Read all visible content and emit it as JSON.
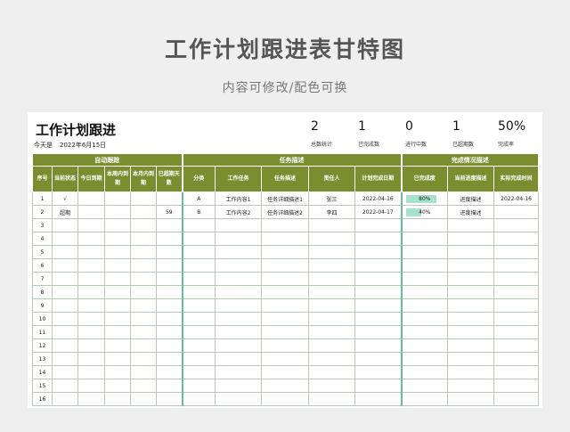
{
  "banner": {
    "title": "工作计划跟进表甘特图",
    "subtitle": "内容可修改/配色可换"
  },
  "doc": {
    "title": "工作计划跟进",
    "today_label": "今天是",
    "today_value": "2022年6月15日"
  },
  "stats": [
    {
      "value": "2",
      "label": "总数统计"
    },
    {
      "value": "1",
      "label": "已完成数"
    },
    {
      "value": "0",
      "label": "进行中数"
    },
    {
      "value": "1",
      "label": "已超期数"
    },
    {
      "value": "50%",
      "label": "完成率"
    }
  ],
  "groups": {
    "auto": "自动跟踪",
    "task": "任务描述",
    "status": "完成情况描述"
  },
  "columns": {
    "seq": "序号",
    "cur_status": "当前状态",
    "today_due": "今日到期",
    "week_due": "本周内到期",
    "month_due": "本月内到期",
    "overdue_days": "已超期天数",
    "category": "分类",
    "work_task": "工作任务",
    "task_desc": "任务描述",
    "owner": "责任人",
    "plan_date": "计划完成日期",
    "done_pct": "已完成度",
    "cur_progress": "当前进度描述",
    "actual_date": "实际完成时间"
  },
  "rows": [
    {
      "seq": "1",
      "status": "√",
      "overdue": "",
      "category": "A",
      "task": "工作内容1",
      "desc": "任务详细描述1",
      "owner": "张三",
      "plan": "2022-04-16",
      "pct": 0.8,
      "pct_label": "80%",
      "progress": "进度描述",
      "actual": "2022-04-16"
    },
    {
      "seq": "2",
      "status": "超期",
      "overdue": "59",
      "category": "B",
      "task": "工作内容2",
      "desc": "任务详细描述2",
      "owner": "李四",
      "plan": "2022-04-17",
      "pct": 0.4,
      "pct_label": "40%",
      "progress": "进度描述",
      "actual": ""
    }
  ],
  "empty_rows": [
    "3",
    "4",
    "5",
    "6",
    "7",
    "8",
    "9",
    "10",
    "11",
    "12",
    "13",
    "14",
    "15",
    "16"
  ],
  "colors": {
    "header": "#7a8e2f",
    "accent": "#6fb8a0",
    "progress": "#a6e2cc",
    "alert": "#e02020"
  }
}
